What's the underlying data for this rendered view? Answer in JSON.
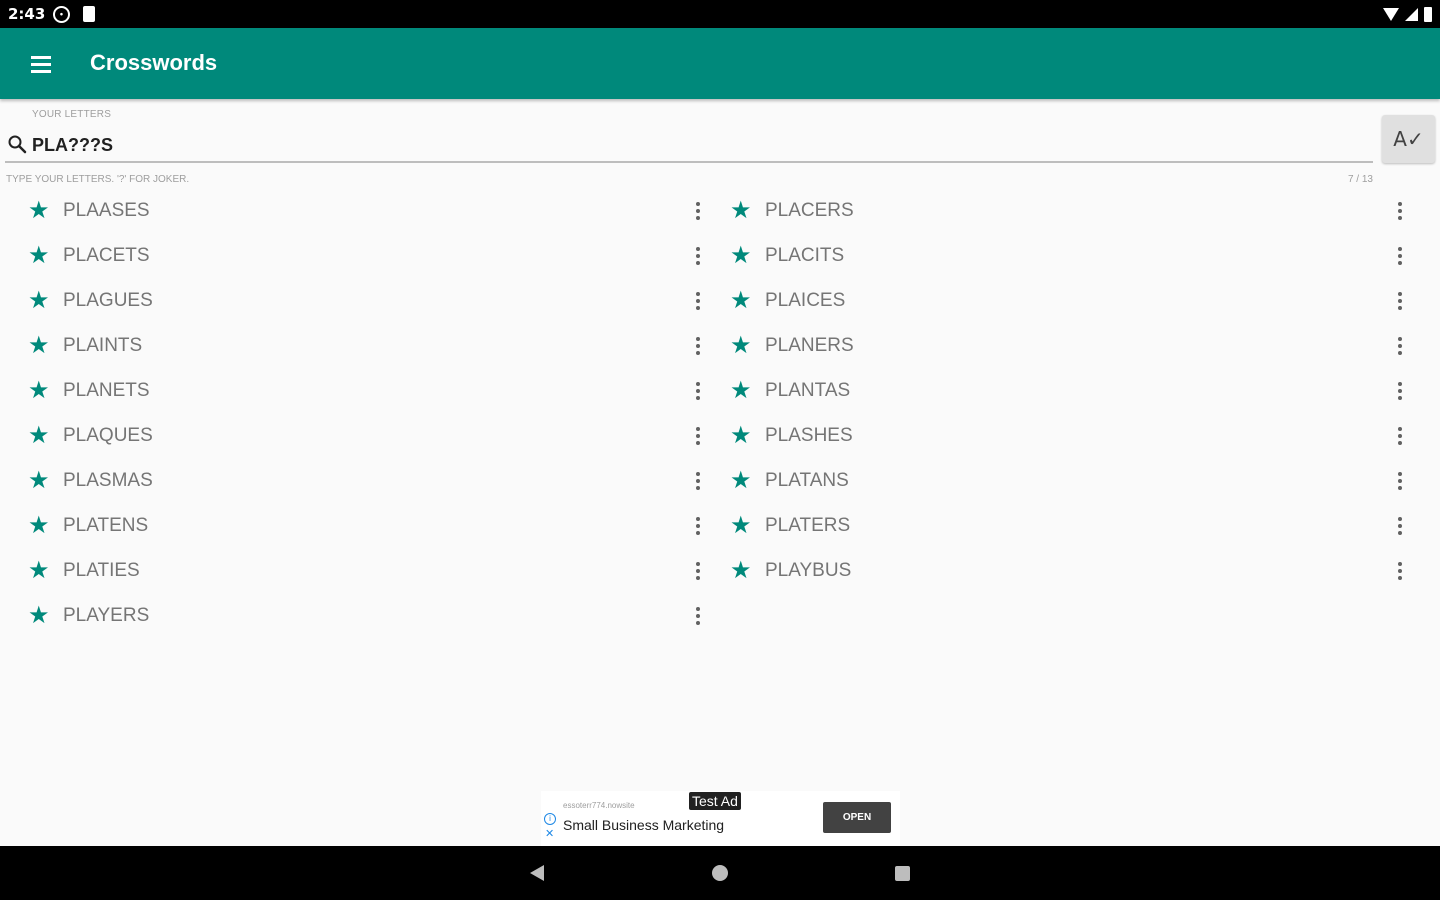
{
  "status_bar": {
    "time": "2:43",
    "left_icons": [
      "notification-icon",
      "sd-card-icon"
    ],
    "right_icons": [
      "wifi-icon",
      "signal-icon",
      "battery-icon"
    ]
  },
  "app_bar": {
    "title": "Crosswords",
    "menu_icon": "hamburger-menu-icon",
    "background": "#00897b"
  },
  "search": {
    "label": "YOUR LETTERS",
    "value": "PLA???S",
    "helper": "TYPE YOUR LETTERS. '?' FOR JOKER.",
    "counter": "7 / 13",
    "spell_button_glyph": "A✓"
  },
  "results": {
    "star_color": "#00897b",
    "left_column": [
      "PLAASES",
      "PLACETS",
      "PLAGUES",
      "PLAINTS",
      "PLANETS",
      "PLAQUES",
      "PLASMAS",
      "PLATENS",
      "PLATIES",
      "PLAYERS"
    ],
    "right_column": [
      "PLACERS",
      "PLACITS",
      "PLAICES",
      "PLANERS",
      "PLANTAS",
      "PLASHES",
      "PLATANS",
      "PLATERS",
      "PLAYBUS"
    ]
  },
  "ad": {
    "url": "essoterr774.nowsite",
    "badge": "Test Ad",
    "headline": "Small Business Marketing",
    "button": "OPEN"
  },
  "nav_bar": {
    "icons": [
      "back-icon",
      "home-icon",
      "recents-icon"
    ]
  }
}
